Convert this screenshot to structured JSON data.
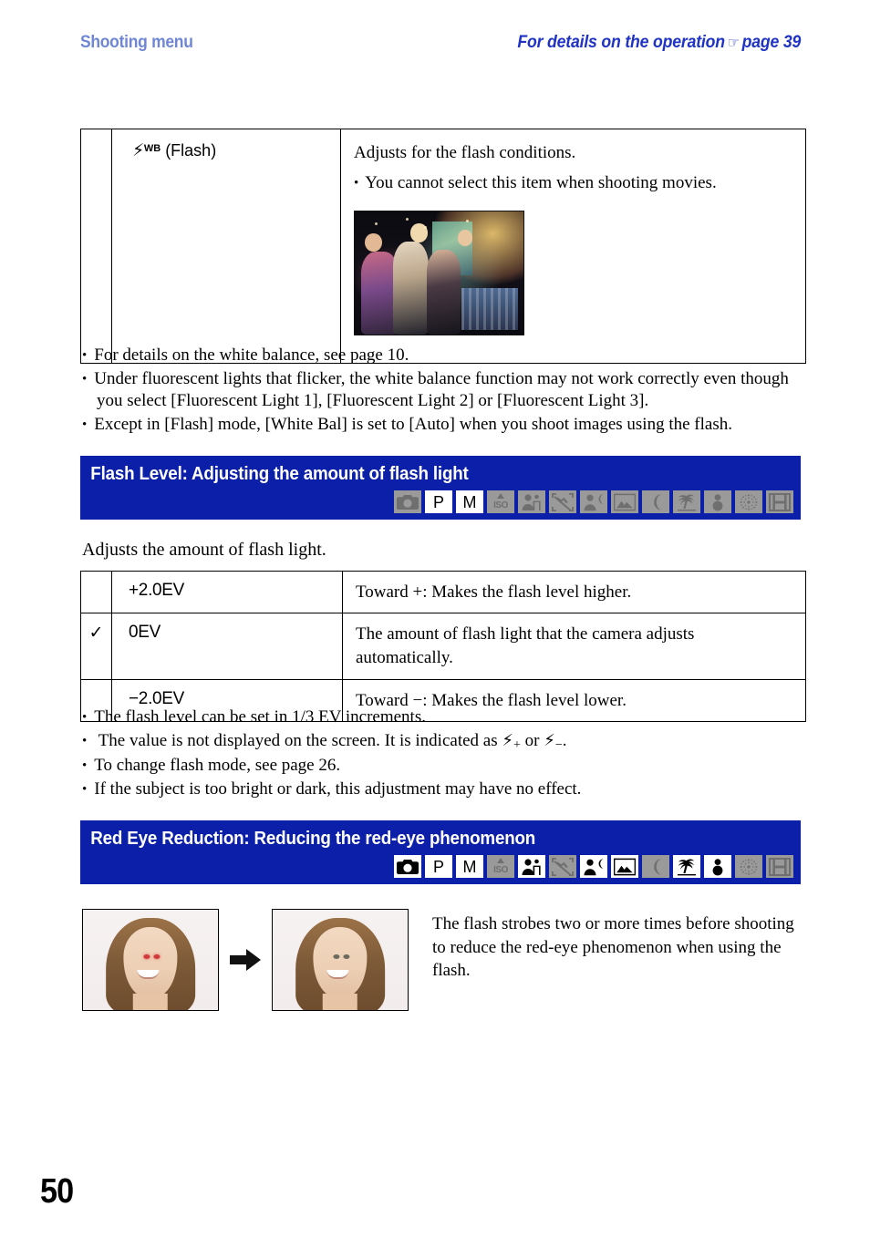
{
  "running_head": {
    "left": "Shooting menu",
    "right_before": "For details on the operation",
    "right_pointer": "☞",
    "right_after": "page 39"
  },
  "flash_wb_table": {
    "term_label": "(Flash)",
    "term_icon": "flash-wb-icon",
    "lead": "Adjusts for the flash conditions.",
    "note": "You cannot select this item when shooting movies.",
    "sample_image": "night-party-photo"
  },
  "white_balance_notes": [
    "For details on the white balance, see page 10.",
    "Under fluorescent lights that flicker, the white balance function may not work correctly even though you select [Fluorescent Light 1], [Fluorescent Light 2] or [Fluorescent Light 3].",
    "Except in [Flash] mode, [White Bal] is set to [Auto] when you shoot images using the flash."
  ],
  "flash_level_section": {
    "banner_title": "Flash Level: Adjusting the amount of flash light",
    "banner_color": "#0b1fa8",
    "mode_icons": [
      {
        "name": "camera-auto-mode-icon",
        "glyph": "camera",
        "active": false
      },
      {
        "name": "program-mode-icon",
        "glyph": "P",
        "active": true
      },
      {
        "name": "manual-mode-icon",
        "glyph": "M",
        "active": true
      },
      {
        "name": "high-sensitivity-mode-icon",
        "glyph": "ISO",
        "active": false
      },
      {
        "name": "soft-snap-mode-icon",
        "glyph": "soft-snap",
        "active": false
      },
      {
        "name": "no-flash-mode-icon",
        "glyph": "crossed",
        "active": false
      },
      {
        "name": "twilight-portrait-mode-icon",
        "glyph": "portrait-moon",
        "active": false
      },
      {
        "name": "landscape-mode-icon",
        "glyph": "landscape",
        "active": false
      },
      {
        "name": "twilight-mode-icon",
        "glyph": "moon",
        "active": false
      },
      {
        "name": "beach-mode-icon",
        "glyph": "beach",
        "active": false
      },
      {
        "name": "snow-mode-icon",
        "glyph": "snow",
        "active": false
      },
      {
        "name": "fireworks-mode-icon",
        "glyph": "fireworks",
        "active": false
      },
      {
        "name": "movie-mode-icon",
        "glyph": "movie",
        "active": false
      }
    ],
    "intro": "Adjusts the amount of flash light.",
    "rows": [
      {
        "checked": false,
        "term": "+2.0EV",
        "desc": "Toward +: Makes the flash level higher."
      },
      {
        "checked": true,
        "term": "0EV",
        "desc": "The amount of flash light that the camera adjusts automatically."
      },
      {
        "checked": false,
        "term": "−2.0EV",
        "desc": "Toward −: Makes the flash level lower."
      }
    ],
    "check_glyph": "✓",
    "notes": [
      "The flash level can be set in 1/3 EV increments.",
      "The value is not displayed on the screen. It is indicated as ⚡+ or ⚡−.",
      "To change flash mode, see page 26.",
      "If the subject is too bright or dark, this adjustment may have no effect."
    ],
    "note_indicator_plus": "+",
    "note_indicator_minus": "−"
  },
  "red_eye_section": {
    "banner_title": "Red Eye Reduction: Reducing the red-eye phenomenon",
    "banner_color": "#0b1fa8",
    "mode_icons": [
      {
        "name": "camera-auto-mode-icon",
        "glyph": "camera",
        "active": true
      },
      {
        "name": "program-mode-icon",
        "glyph": "P",
        "active": true
      },
      {
        "name": "manual-mode-icon",
        "glyph": "M",
        "active": true
      },
      {
        "name": "high-sensitivity-mode-icon",
        "glyph": "ISO",
        "active": false
      },
      {
        "name": "soft-snap-mode-icon",
        "glyph": "soft-snap",
        "active": true
      },
      {
        "name": "no-flash-mode-icon",
        "glyph": "crossed",
        "active": false
      },
      {
        "name": "twilight-portrait-mode-icon",
        "glyph": "portrait-moon",
        "active": true
      },
      {
        "name": "landscape-mode-icon",
        "glyph": "landscape",
        "active": true
      },
      {
        "name": "twilight-mode-icon",
        "glyph": "moon",
        "active": false
      },
      {
        "name": "beach-mode-icon",
        "glyph": "beach",
        "active": true
      },
      {
        "name": "snow-mode-icon",
        "glyph": "snow",
        "active": true
      },
      {
        "name": "fireworks-mode-icon",
        "glyph": "fireworks",
        "active": false
      },
      {
        "name": "movie-mode-icon",
        "glyph": "movie",
        "active": false
      }
    ],
    "before_image": "portrait-with-red-eyes",
    "after_image": "portrait-without-red-eyes",
    "arrow": "right-arrow-icon",
    "description": "The flash strobes two or more times before shooting to reduce the red-eye phenomenon when using the flash."
  },
  "folio": "50"
}
